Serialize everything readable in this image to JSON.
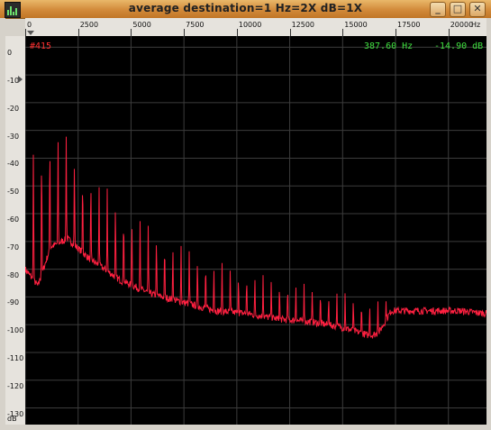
{
  "window": {
    "title": "average    destination=1 Hz=2X dB=1X",
    "buttons": {
      "minimize": "_",
      "maximize": "□",
      "close": "✕"
    }
  },
  "ruler_top": {
    "labels": [
      "0",
      "2500",
      "5000",
      "7500",
      "10000",
      "12500",
      "15000",
      "17500",
      "20000",
      "Hz"
    ]
  },
  "ruler_left": {
    "labels": [
      "0",
      "-10",
      "-20",
      "-30",
      "-40",
      "-50",
      "-60",
      "-70",
      "-80",
      "-90",
      "-100",
      "-110",
      "-120",
      "-130",
      "dB"
    ]
  },
  "readouts": {
    "marker": "#415",
    "frequency": "387.60 Hz",
    "level": "-14.90 dB"
  },
  "colors": {
    "trace": "#ff2040",
    "marker_text": "#ff3030",
    "readout_text": "#40e040",
    "grid": "#3c3c3c",
    "background": "#000000"
  },
  "chart_data": {
    "type": "line",
    "xlabel": "Hz",
    "ylabel": "dB",
    "xlim": [
      0,
      21800
    ],
    "ylim": [
      -136,
      4
    ],
    "harmonics": {
      "fundamental_hz": 387.6,
      "count": 44,
      "peak_db": [
        -28,
        -25,
        -24,
        -27,
        -31,
        -36,
        -40,
        -42,
        -46,
        -49,
        -52,
        -54,
        -57,
        -60,
        -62,
        -64,
        -66,
        -68,
        -70,
        -71,
        -73,
        -74,
        -76,
        -77,
        -78,
        -79,
        -80,
        -81,
        -82,
        -82,
        -83,
        -84,
        -84,
        -85,
        -85,
        -86,
        -87,
        -87,
        -88,
        -89,
        -89,
        -90,
        -90,
        -91
      ]
    },
    "floor": {
      "x": [
        0,
        600,
        1200,
        2000,
        3000,
        4500,
        6000,
        7500,
        9000,
        10500,
        12000,
        13500,
        15000,
        16300,
        16700,
        17300,
        18500,
        19500,
        20500,
        21800
      ],
      "db": [
        -80,
        -86,
        -72,
        -69,
        -76,
        -84,
        -89,
        -92,
        -95,
        -96,
        -98,
        -99,
        -101,
        -104,
        -103,
        -95,
        -95,
        -95,
        -95,
        -96
      ]
    }
  }
}
